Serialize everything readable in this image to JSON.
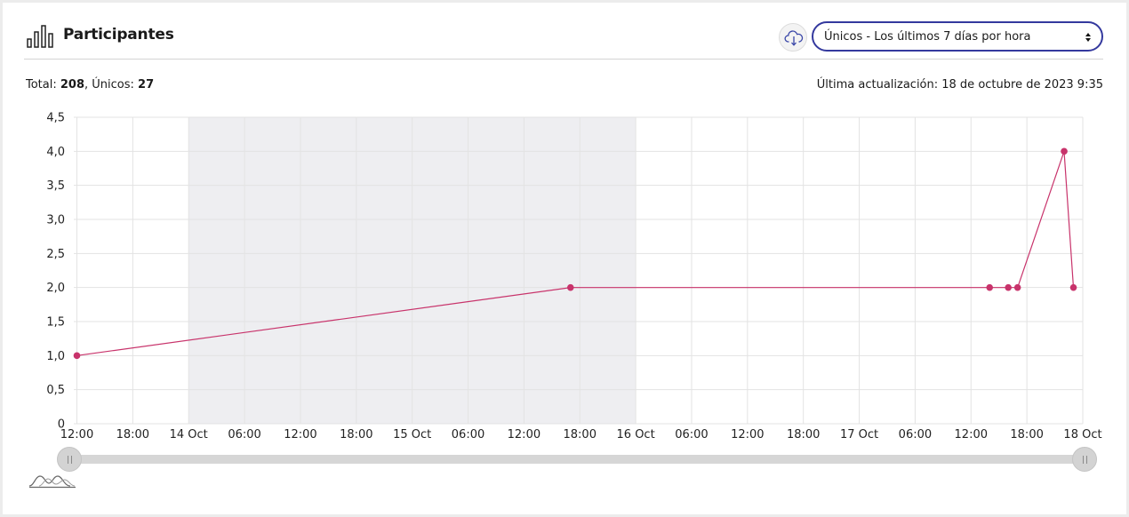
{
  "header": {
    "title": "Participantes",
    "icon": "bar-chart-icon",
    "download_icon": "cloud-download-icon",
    "select_value": "Únicos - Los últimos 7 días por hora"
  },
  "stats": {
    "total_label": "Total: ",
    "total_value": "208",
    "separator": ", ",
    "unique_label": "Únicos: ",
    "unique_value": "27",
    "last_update": "Última actualización: 18 de octubre de 2023 9:35"
  },
  "colors": {
    "line": "#c8336b",
    "shade": "#eeeef1",
    "select_border": "#34399e"
  },
  "chart_data": {
    "type": "line",
    "title": "",
    "xlabel": "",
    "ylabel": "",
    "ylim": [
      0,
      4.5
    ],
    "yticks": [
      "0",
      "0,5",
      "1,0",
      "1,5",
      "2,0",
      "2,5",
      "3,0",
      "3,5",
      "4,0",
      "4,5"
    ],
    "x_range": [
      "2023-10-13 11:40",
      "2023-10-18 00:00"
    ],
    "xticks": [
      {
        "t": "2023-10-13 12:00",
        "label": "12:00"
      },
      {
        "t": "2023-10-13 18:00",
        "label": "18:00"
      },
      {
        "t": "2023-10-14 00:00",
        "label": "14 Oct"
      },
      {
        "t": "2023-10-14 06:00",
        "label": "06:00"
      },
      {
        "t": "2023-10-14 12:00",
        "label": "12:00"
      },
      {
        "t": "2023-10-14 18:00",
        "label": "18:00"
      },
      {
        "t": "2023-10-15 00:00",
        "label": "15 Oct"
      },
      {
        "t": "2023-10-15 06:00",
        "label": "06:00"
      },
      {
        "t": "2023-10-15 12:00",
        "label": "12:00"
      },
      {
        "t": "2023-10-15 18:00",
        "label": "18:00"
      },
      {
        "t": "2023-10-16 00:00",
        "label": "16 Oct"
      },
      {
        "t": "2023-10-16 06:00",
        "label": "06:00"
      },
      {
        "t": "2023-10-16 12:00",
        "label": "12:00"
      },
      {
        "t": "2023-10-16 18:00",
        "label": "18:00"
      },
      {
        "t": "2023-10-17 00:00",
        "label": "17 Oct"
      },
      {
        "t": "2023-10-17 06:00",
        "label": "06:00"
      },
      {
        "t": "2023-10-17 12:00",
        "label": "12:00"
      },
      {
        "t": "2023-10-17 18:00",
        "label": "18:00"
      },
      {
        "t": "2023-10-18 00:00",
        "label": "18 Oct"
      }
    ],
    "shaded_range": [
      "2023-10-14 00:00",
      "2023-10-16 00:00"
    ],
    "grid": true,
    "series": [
      {
        "points": [
          {
            "t": "2023-10-13 12:00",
            "y": 1
          },
          {
            "t": "2023-10-15 17:00",
            "y": 2
          },
          {
            "t": "2023-10-17 14:00",
            "y": 2
          },
          {
            "t": "2023-10-17 16:00",
            "y": 2
          },
          {
            "t": "2023-10-17 17:00",
            "y": 2
          },
          {
            "t": "2023-10-17 22:00",
            "y": 4
          },
          {
            "t": "2023-10-17 23:00",
            "y": 2
          }
        ]
      }
    ]
  }
}
